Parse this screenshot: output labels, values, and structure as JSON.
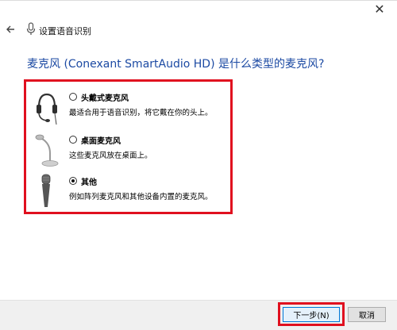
{
  "window": {
    "close_glyph": "✕",
    "title": "设置语音识别"
  },
  "icons": {
    "back": "arrow-left-icon",
    "mic": "microphone-icon",
    "headset": "headset-microphone-icon",
    "desk": "desktop-microphone-icon",
    "other": "handheld-microphone-icon"
  },
  "question": "麦克风 (Conexant SmartAudio HD) 是什么类型的麦克风?",
  "options": [
    {
      "label": "头戴式麦克风",
      "desc": "最适合用于语音识别，将它戴在你的头上。",
      "checked": false
    },
    {
      "label": "桌面麦克风",
      "desc": "这些麦克风放在桌面上。",
      "checked": false
    },
    {
      "label": "其他",
      "desc": "例如阵列麦克风和其他设备内置的麦克风。",
      "checked": true
    }
  ],
  "buttons": {
    "next": "下一步(N)",
    "cancel": "取消"
  },
  "colors": {
    "question_text": "#1c4aa3",
    "highlight_border": "#e0101f"
  }
}
